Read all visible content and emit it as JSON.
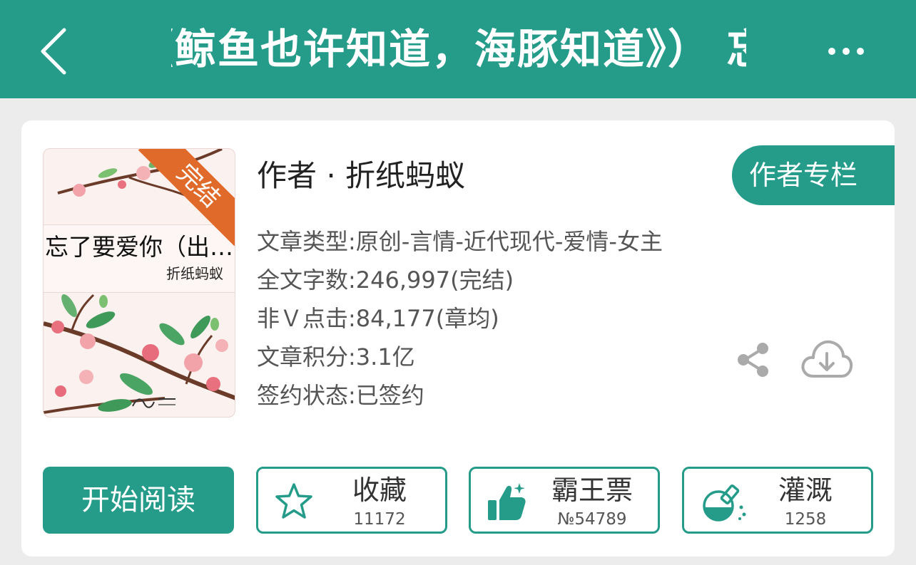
{
  "header": {
    "title": "《鲸鱼也许知道，海豚知道》） 忘了要爱你（出版名）",
    "back_icon": "chevron-left-icon",
    "more_icon": "more-horizontal-icon"
  },
  "book": {
    "cover": {
      "title": "忘了要爱你（出…",
      "author": "折纸蚂蚁",
      "status_ribbon": "完结",
      "publisher_logo": "晋江文学城"
    },
    "author_line": "作者 · 折纸蚂蚁",
    "author_column_button": "作者专栏",
    "meta": [
      "文章类型:原创-言情-近代现代-爱情-女主",
      "全文字数:246,997(完结)",
      "非Ｖ点击:84,177(章均)",
      "文章积分:3.1亿",
      "签约状态:已签约"
    ],
    "share_icon": "share-icon",
    "download_icon": "cloud-download-icon"
  },
  "actions": {
    "read_button": "开始阅读",
    "collect": {
      "label": "收藏",
      "count": "11172",
      "icon": "star-icon"
    },
    "vote": {
      "label": "霸王票",
      "count": "№54789",
      "icon": "thumbs-up-icon"
    },
    "water": {
      "label": "灌溉",
      "count": "1258",
      "icon": "nutrient-flask-icon"
    }
  },
  "colors": {
    "accent": "#259c8a",
    "ribbon": "#e06a2a",
    "background": "#ececec"
  }
}
